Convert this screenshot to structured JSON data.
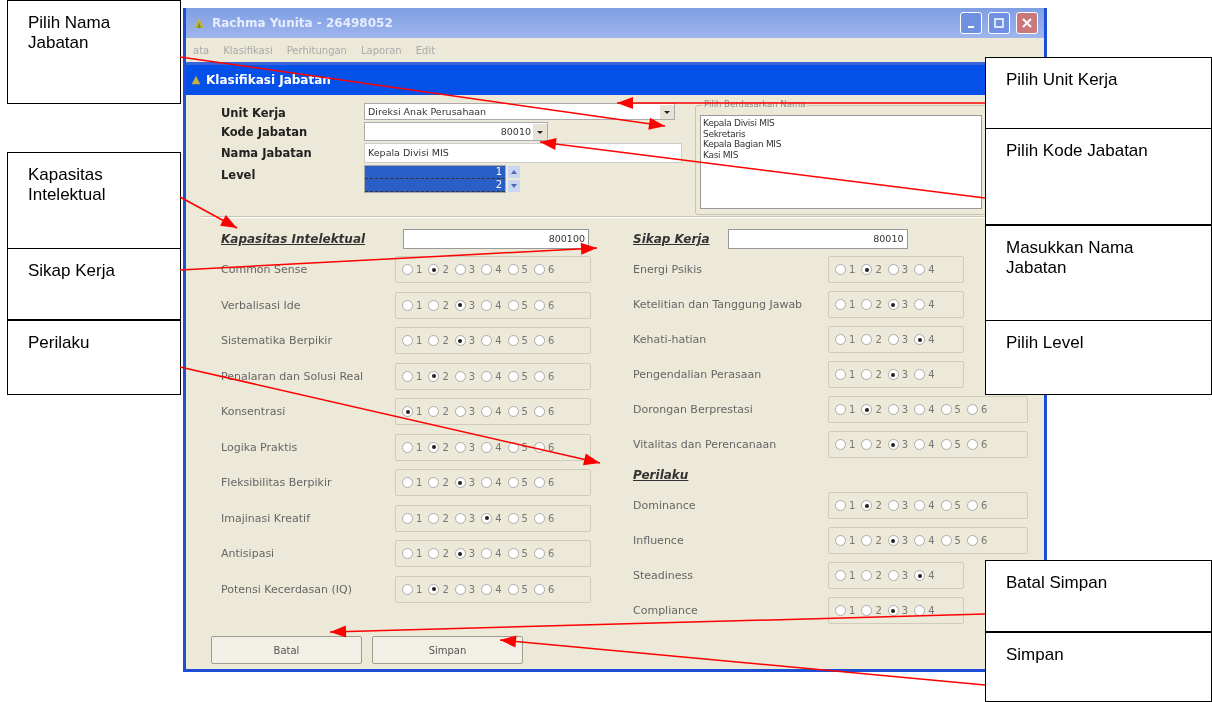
{
  "window": {
    "title": "Rachma Yunita - 26498052"
  },
  "menu": [
    "ata",
    "Klasifikasi",
    "Perhitungan",
    "Laporan",
    "Edit"
  ],
  "child_window": {
    "title": "Klasifikasi Jabatan"
  },
  "fields": [
    {
      "kind": "combo",
      "label": "Unit Kerja",
      "value": "Direksi Anak Perusahaan"
    },
    {
      "kind": "dropdown",
      "label": "Kode Jabatan",
      "value": "80010"
    },
    {
      "kind": "text",
      "label": "Nama Jabatan",
      "value": "Kepala Divisi MIS"
    },
    {
      "kind": "list",
      "label": "Level",
      "items": [
        {
          "text": "1",
          "selected": true
        },
        {
          "text": "2",
          "selected": true
        }
      ]
    }
  ],
  "name_list": {
    "title": "Pilih Berdasarkan Nama",
    "items": [
      "Kepala Divisi MIS",
      "Sekretaris",
      "Kepala Bagian MIS",
      "Kasi MIS"
    ]
  },
  "left_sections": [
    {
      "title": "Kapasitas Intelektual",
      "value": "800100",
      "rows": [
        {
          "label": "Common Sense",
          "options": [
            {
              "label": "1",
              "selected": false
            },
            {
              "label": "2",
              "selected": true
            },
            {
              "label": "3",
              "selected": false
            },
            {
              "label": "4",
              "selected": false
            },
            {
              "label": "5",
              "selected": false
            },
            {
              "label": "6",
              "selected": false
            }
          ]
        },
        {
          "label": "Verbalisasi Ide",
          "options": [
            {
              "label": "1",
              "selected": false
            },
            {
              "label": "2",
              "selected": false
            },
            {
              "label": "3",
              "selected": true
            },
            {
              "label": "4",
              "selected": false
            },
            {
              "label": "5",
              "selected": false
            },
            {
              "label": "6",
              "selected": false
            }
          ]
        },
        {
          "label": "Sistematika Berpikir",
          "options": [
            {
              "label": "1",
              "selected": false
            },
            {
              "label": "2",
              "selected": false
            },
            {
              "label": "3",
              "selected": true
            },
            {
              "label": "4",
              "selected": false
            },
            {
              "label": "5",
              "selected": false
            },
            {
              "label": "6",
              "selected": false
            }
          ]
        },
        {
          "label": "Penalaran dan Solusi Real",
          "options": [
            {
              "label": "1",
              "selected": false
            },
            {
              "label": "2",
              "selected": true
            },
            {
              "label": "3",
              "selected": false
            },
            {
              "label": "4",
              "selected": false
            },
            {
              "label": "5",
              "selected": false
            },
            {
              "label": "6",
              "selected": false
            }
          ]
        },
        {
          "label": "Konsentrasi",
          "options": [
            {
              "label": "1",
              "selected": true
            },
            {
              "label": "2",
              "selected": false
            },
            {
              "label": "3",
              "selected": false
            },
            {
              "label": "4",
              "selected": false
            },
            {
              "label": "5",
              "selected": false
            },
            {
              "label": "6",
              "selected": false
            }
          ]
        },
        {
          "label": "Logika Praktis",
          "options": [
            {
              "label": "1",
              "selected": false
            },
            {
              "label": "2",
              "selected": true
            },
            {
              "label": "3",
              "selected": false
            },
            {
              "label": "4",
              "selected": false
            },
            {
              "label": "5",
              "selected": false
            },
            {
              "label": "6",
              "selected": false
            }
          ]
        },
        {
          "label": "Fleksibilitas Berpikir",
          "options": [
            {
              "label": "1",
              "selected": false
            },
            {
              "label": "2",
              "selected": false
            },
            {
              "label": "3",
              "selected": true
            },
            {
              "label": "4",
              "selected": false
            },
            {
              "label": "5",
              "selected": false
            },
            {
              "label": "6",
              "selected": false
            }
          ]
        },
        {
          "label": "Imajinasi Kreatif",
          "options": [
            {
              "label": "1",
              "selected": false
            },
            {
              "label": "2",
              "selected": false
            },
            {
              "label": "3",
              "selected": false
            },
            {
              "label": "4",
              "selected": true
            },
            {
              "label": "5",
              "selected": false
            },
            {
              "label": "6",
              "selected": false
            }
          ]
        },
        {
          "label": "Antisipasi",
          "options": [
            {
              "label": "1",
              "selected": false
            },
            {
              "label": "2",
              "selected": false
            },
            {
              "label": "3",
              "selected": true
            },
            {
              "label": "4",
              "selected": false
            },
            {
              "label": "5",
              "selected": false
            },
            {
              "label": "6",
              "selected": false
            }
          ]
        },
        {
          "label": "Potensi Kecerdasan (IQ)",
          "options": [
            {
              "label": "1",
              "selected": false
            },
            {
              "label": "2",
              "selected": true
            },
            {
              "label": "3",
              "selected": false
            },
            {
              "label": "4",
              "selected": false
            },
            {
              "label": "5",
              "selected": false
            },
            {
              "label": "6",
              "selected": false
            }
          ]
        }
      ]
    }
  ],
  "right_sections": [
    {
      "title": "Sikap Kerja",
      "value": "80010",
      "rows": [
        {
          "label": "Energi Psikis",
          "options": [
            {
              "label": "1",
              "selected": false
            },
            {
              "label": "2",
              "selected": true
            },
            {
              "label": "3",
              "selected": false
            },
            {
              "label": "4",
              "selected": false
            }
          ]
        },
        {
          "label": "Ketelitian dan Tanggung Jawab",
          "options": [
            {
              "label": "1",
              "selected": false
            },
            {
              "label": "2",
              "selected": false
            },
            {
              "label": "3",
              "selected": true
            },
            {
              "label": "4",
              "selected": false
            }
          ]
        },
        {
          "label": "Kehati-hatian",
          "options": [
            {
              "label": "1",
              "selected": false
            },
            {
              "label": "2",
              "selected": false
            },
            {
              "label": "3",
              "selected": false
            },
            {
              "label": "4",
              "selected": true
            }
          ]
        },
        {
          "label": "Pengendalian Perasaan",
          "options": [
            {
              "label": "1",
              "selected": false
            },
            {
              "label": "2",
              "selected": false
            },
            {
              "label": "3",
              "selected": true
            },
            {
              "label": "4",
              "selected": false
            }
          ]
        },
        {
          "label": "Dorongan Berprestasi",
          "options": [
            {
              "label": "1",
              "selected": false
            },
            {
              "label": "2",
              "selected": true
            },
            {
              "label": "3",
              "selected": false
            },
            {
              "label": "4",
              "selected": false
            },
            {
              "label": "5",
              "selected": false
            },
            {
              "label": "6",
              "selected": false
            }
          ]
        },
        {
          "label": "Vitalitas dan Perencanaan",
          "options": [
            {
              "label": "1",
              "selected": false
            },
            {
              "label": "2",
              "selected": false
            },
            {
              "label": "3",
              "selected": true
            },
            {
              "label": "4",
              "selected": false
            },
            {
              "label": "5",
              "selected": false
            },
            {
              "label": "6",
              "selected": false
            }
          ]
        }
      ]
    },
    {
      "title": "Perilaku",
      "rows": [
        {
          "label": "Dominance",
          "options": [
            {
              "label": "1",
              "selected": false
            },
            {
              "label": "2",
              "selected": true
            },
            {
              "label": "3",
              "selected": false
            },
            {
              "label": "4",
              "selected": false
            },
            {
              "label": "5",
              "selected": false
            },
            {
              "label": "6",
              "selected": false
            }
          ]
        },
        {
          "label": "Influence",
          "options": [
            {
              "label": "1",
              "selected": false
            },
            {
              "label": "2",
              "selected": false
            },
            {
              "label": "3",
              "selected": true
            },
            {
              "label": "4",
              "selected": false
            },
            {
              "label": "5",
              "selected": false
            },
            {
              "label": "6",
              "selected": false
            }
          ]
        },
        {
          "label": "Steadiness",
          "options": [
            {
              "label": "1",
              "selected": false
            },
            {
              "label": "2",
              "selected": false
            },
            {
              "label": "3",
              "selected": false
            },
            {
              "label": "4",
              "selected": true
            }
          ]
        },
        {
          "label": "Compliance",
          "options": [
            {
              "label": "1",
              "selected": false
            },
            {
              "label": "2",
              "selected": false
            },
            {
              "label": "3",
              "selected": true
            },
            {
              "label": "4",
              "selected": false
            }
          ]
        }
      ]
    }
  ],
  "buttons": [
    "Batal",
    "Simpan"
  ],
  "callouts": [
    "Pilih Nama Jabatan",
    "Kapasitas Intelektual",
    "Sikap Kerja",
    "Perilaku",
    "Pilih Unit Kerja",
    "Pilih Kode Jabatan",
    "Masukkan Nama Jabatan",
    "Pilih Level",
    "Batal Simpan",
    "Simpan"
  ]
}
